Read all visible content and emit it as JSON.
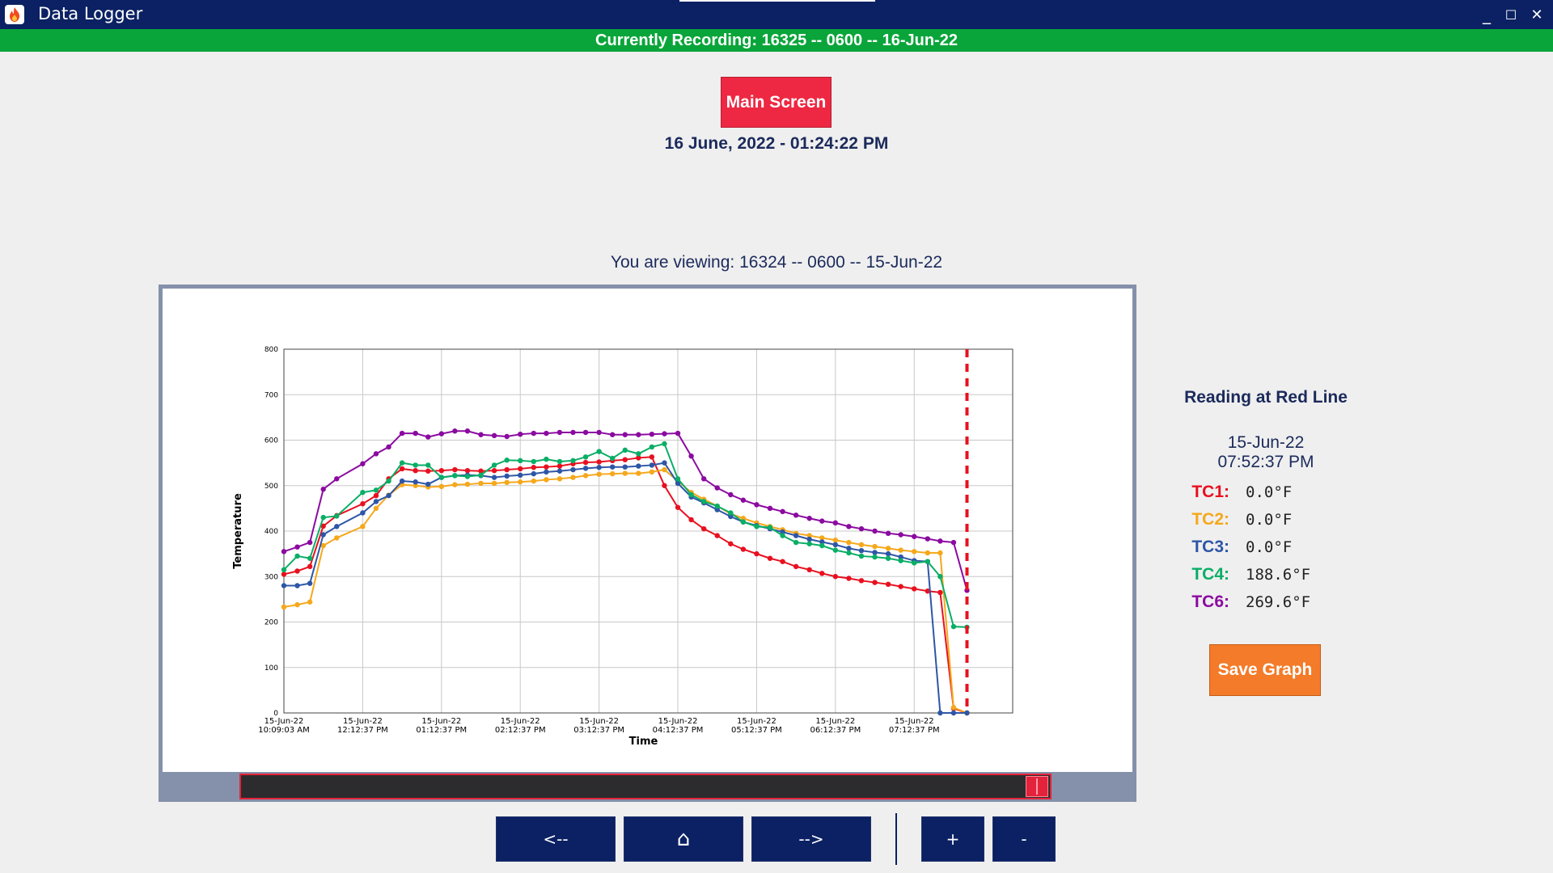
{
  "window": {
    "title": "Data Logger",
    "icon": "flame-icon",
    "controls": {
      "minimize": "_",
      "maximize": "☐",
      "close": "✕"
    }
  },
  "banner": {
    "text": "Currently Recording: 16325 -- 0600 -- 16-Jun-22",
    "color": "#0aa53a"
  },
  "main_screen_button": "Main Screen",
  "current_datetime": "16 June, 2022 - 01:24:22 PM",
  "viewing_text": "You are viewing: 16324 -- 0600 -- 15-Jun-22",
  "reading_panel": {
    "title": "Reading at Red Line",
    "date": "15-Jun-22",
    "time": "07:52:37 PM",
    "rows": [
      {
        "label": "TC1:",
        "value": "0.0°F",
        "color": "#e8101f"
      },
      {
        "label": "TC2:",
        "value": "0.0°F",
        "color": "#f5a81c"
      },
      {
        "label": "TC3:",
        "value": "0.0°F",
        "color": "#2e56a6"
      },
      {
        "label": "TC4:",
        "value": "188.6°F",
        "color": "#0aae66"
      },
      {
        "label": "TC6:",
        "value": "269.6°F",
        "color": "#8b0aa0"
      }
    ]
  },
  "save_graph_button": "Save Graph",
  "nav": {
    "back": "<--",
    "home": "⌂",
    "forward": "-->",
    "zoom_in": "+",
    "zoom_out": "-"
  },
  "scrollbar": {
    "position": 0.985
  },
  "chart_data": {
    "type": "line",
    "xlabel": "Time",
    "ylabel": "Temperature",
    "ylim": [
      0,
      800
    ],
    "yticks": [
      0,
      100,
      200,
      300,
      400,
      500,
      600,
      700,
      800
    ],
    "xlim": [
      0,
      9.25
    ],
    "xticks": [
      {
        "x": 0,
        "date": "15-Jun-22",
        "time": "10:09:03 AM"
      },
      {
        "x": 1,
        "date": "15-Jun-22",
        "time": "12:12:37 PM"
      },
      {
        "x": 2,
        "date": "15-Jun-22",
        "time": "01:12:37 PM"
      },
      {
        "x": 3,
        "date": "15-Jun-22",
        "time": "02:12:37 PM"
      },
      {
        "x": 4,
        "date": "15-Jun-22",
        "time": "03:12:37 PM"
      },
      {
        "x": 5,
        "date": "15-Jun-22",
        "time": "04:12:37 PM"
      },
      {
        "x": 6,
        "date": "15-Jun-22",
        "time": "05:12:37 PM"
      },
      {
        "x": 7,
        "date": "15-Jun-22",
        "time": "06:12:37 PM"
      },
      {
        "x": 8,
        "date": "15-Jun-22",
        "time": "07:12:37 PM"
      }
    ],
    "red_line_x": 8.67,
    "grid": true,
    "x": [
      0,
      0.17,
      0.33,
      0.5,
      0.67,
      1,
      1.17,
      1.33,
      1.5,
      1.67,
      1.83,
      2,
      2.17,
      2.33,
      2.5,
      2.67,
      2.83,
      3,
      3.17,
      3.33,
      3.5,
      3.67,
      3.83,
      4,
      4.17,
      4.33,
      4.5,
      4.67,
      4.83,
      5,
      5.17,
      5.33,
      5.5,
      5.67,
      5.83,
      6,
      6.17,
      6.33,
      6.5,
      6.67,
      6.83,
      7,
      7.17,
      7.33,
      7.5,
      7.67,
      7.83,
      8,
      8.17,
      8.33,
      8.5,
      8.67
    ],
    "series": [
      {
        "label": "TC1",
        "color": "#e8101f",
        "values": [
          305,
          312,
          322,
          411,
          434,
          460,
          478,
          515,
          537,
          533,
          532,
          533,
          535,
          533,
          532,
          533,
          535,
          537,
          540,
          541,
          543,
          548,
          551,
          552,
          555,
          557,
          561,
          563,
          500,
          452,
          425,
          405,
          390,
          372,
          360,
          350,
          340,
          333,
          322,
          315,
          307,
          300,
          296,
          291,
          287,
          283,
          278,
          273,
          268,
          265,
          10,
          0
        ]
      },
      {
        "label": "TC2",
        "color": "#f5a81c",
        "values": [
          233,
          238,
          244,
          368,
          385,
          410,
          450,
          479,
          502,
          500,
          497,
          498,
          502,
          503,
          505,
          505,
          507,
          508,
          510,
          513,
          515,
          518,
          522,
          525,
          526,
          527,
          527,
          530,
          535,
          510,
          485,
          470,
          455,
          438,
          428,
          418,
          410,
          403,
          395,
          390,
          385,
          380,
          375,
          370,
          366,
          362,
          358,
          355,
          352,
          352,
          12,
          0
        ]
      },
      {
        "label": "TC3",
        "color": "#2e56a6",
        "values": [
          280,
          280,
          285,
          392,
          410,
          440,
          465,
          478,
          510,
          508,
          503,
          518,
          522,
          523,
          522,
          518,
          521,
          523,
          526,
          530,
          532,
          535,
          538,
          540,
          541,
          541,
          543,
          545,
          550,
          505,
          475,
          462,
          447,
          432,
          420,
          412,
          405,
          398,
          390,
          382,
          376,
          370,
          362,
          357,
          353,
          350,
          343,
          335,
          333,
          0,
          0,
          0
        ]
      },
      {
        "label": "TC4",
        "color": "#0aae66",
        "values": [
          315,
          345,
          340,
          430,
          433,
          485,
          490,
          510,
          550,
          545,
          545,
          518,
          522,
          520,
          523,
          545,
          556,
          555,
          553,
          558,
          553,
          555,
          563,
          575,
          560,
          578,
          570,
          585,
          592,
          515,
          480,
          465,
          455,
          440,
          420,
          410,
          408,
          390,
          375,
          372,
          368,
          358,
          352,
          345,
          343,
          340,
          335,
          330,
          333,
          300,
          190,
          188.6
        ]
      },
      {
        "label": "TC6",
        "color": "#8b0aa0",
        "values": [
          355,
          365,
          375,
          492,
          515,
          548,
          570,
          585,
          615,
          615,
          607,
          614,
          620,
          620,
          612,
          610,
          608,
          613,
          615,
          615,
          617,
          617,
          617,
          617,
          612,
          612,
          612,
          613,
          614,
          615,
          565,
          515,
          495,
          480,
          468,
          458,
          450,
          443,
          435,
          428,
          422,
          418,
          410,
          405,
          400,
          395,
          392,
          388,
          383,
          378,
          375,
          269.6
        ]
      }
    ]
  }
}
